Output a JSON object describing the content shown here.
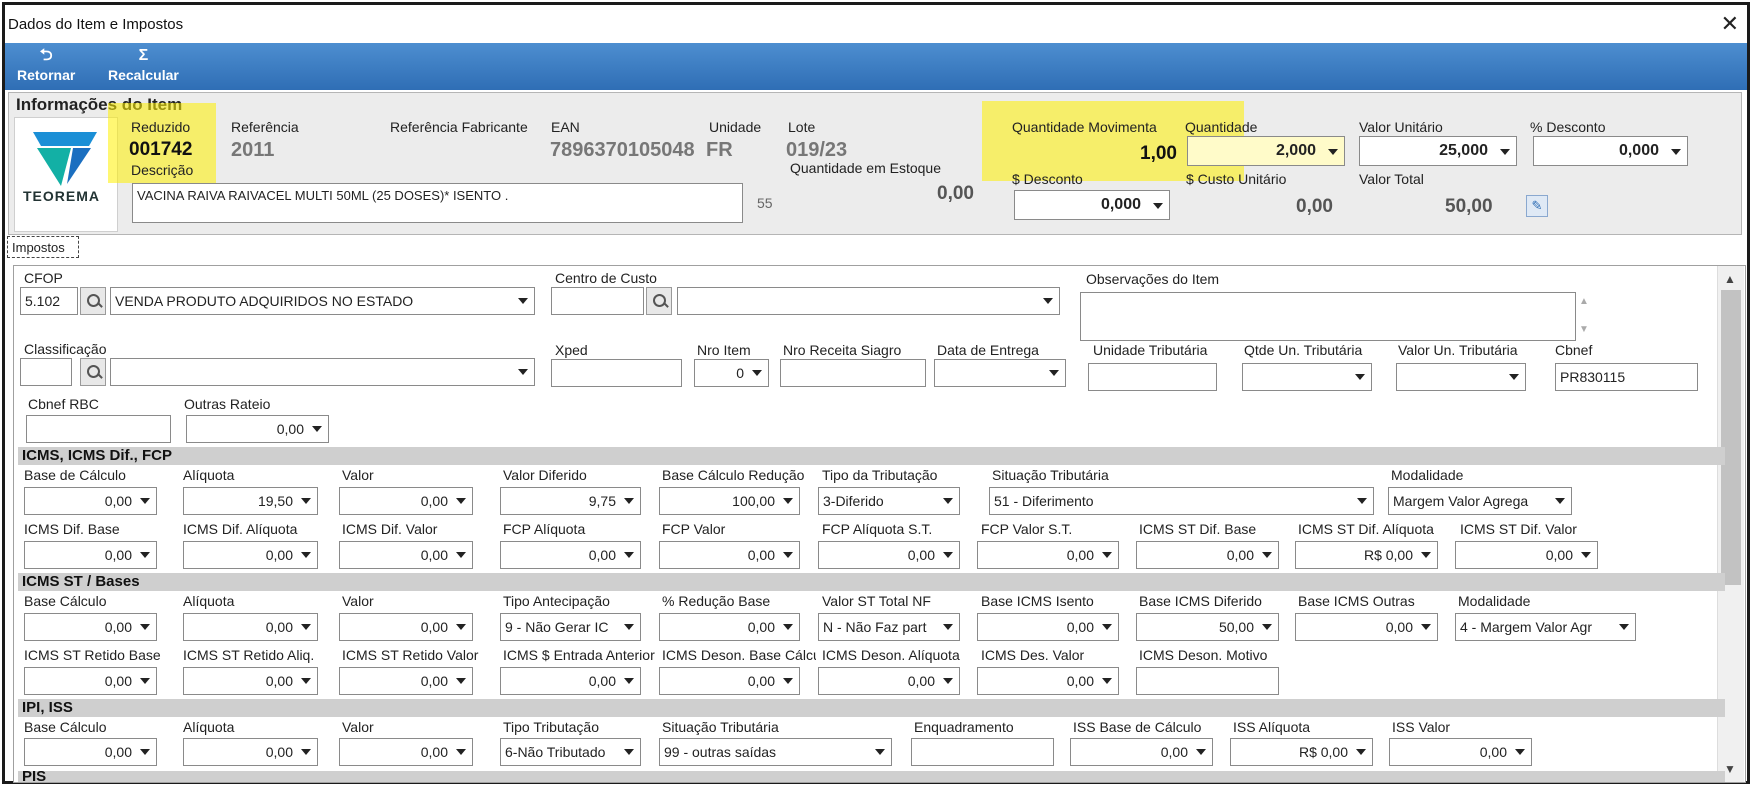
{
  "window": {
    "title": "Dados do Item e Impostos",
    "close": "✕"
  },
  "toolbar": {
    "back_label": "Retornar",
    "recalc_label": "Recalcular"
  },
  "info": {
    "section_title": "Informações do Item",
    "brand": "TEOREMA",
    "reduzido_label": "Reduzido",
    "reduzido_value": "001742",
    "descricao_label": "Descrição",
    "descricao_value": "VACINA RAIVA RAIVACEL MULTI 50ML (25 DOSES)* ISENTO .",
    "desc_code": "55",
    "referencia_label": "Referência",
    "referencia_value": "2011",
    "ref_fabricante_label": "Referência Fabricante",
    "ean_label": "EAN",
    "ean_value": "7896370105048",
    "unidade_label": "Unidade",
    "unidade_value": "FR",
    "lote_label": "Lote",
    "lote_value": "019/23",
    "qtd_estoque_label": "Quantidade em Estoque",
    "qtd_estoque_value": "0,00",
    "qtd_mov_label": "Quantidade Movimenta",
    "qtd_mov_value": "1,00",
    "quantidade_label": "Quantidade",
    "quantidade_value": "2,000",
    "valor_unit_label": "Valor Unitário",
    "valor_unit_value": "25,000",
    "pct_desc_label": "% Desconto",
    "pct_desc_value": "0,000",
    "desconto_label": "$ Desconto",
    "desconto_value": "0,000",
    "custo_unit_label": "$ Custo Unitário",
    "custo_unit_value": "0,00",
    "valor_total_label": "Valor Total",
    "valor_total_value": "50,00"
  },
  "tab": {
    "impostos": "Impostos"
  },
  "fields": {
    "cfop_label": "CFOP",
    "cfop_code": "5.102",
    "cfop_desc": "VENDA PRODUTO ADQUIRIDOS NO ESTADO",
    "centro_label": "Centro de Custo",
    "obs_label": "Observações do Item",
    "classif_label": "Classificação",
    "xped_label": "Xped",
    "nro_item_label": "Nro Item",
    "nro_item_value": "0",
    "nro_receita_label": "Nro Receita Siagro",
    "data_entrega_label": "Data de Entrega",
    "un_trib_label": "Unidade Tributária",
    "qtde_un_trib_label": "Qtde Un. Tributária",
    "valor_un_trib_label": "Valor Un. Tributária",
    "cbnef_label": "Cbnef",
    "cbnef_value": "PR830115",
    "cbnef_rbc_label": "Cbnef RBC",
    "outras_rateio_label": "Outras Rateio",
    "outras_rateio_value": "0,00"
  },
  "icms": {
    "title": "ICMS, ICMS Dif., FCP",
    "r1": [
      {
        "label": "Base de Cálculo",
        "value": "0,00"
      },
      {
        "label": "Alíquota",
        "value": "19,50"
      },
      {
        "label": "Valor",
        "value": "0,00"
      },
      {
        "label": "Valor Diferido",
        "value": "9,75"
      },
      {
        "label": "Base Cálculo Redução",
        "value": "100,00"
      }
    ],
    "tipo_trib_label": "Tipo da Tributação",
    "tipo_trib_value": "3-Diferido",
    "sit_trib_label": "Situação Tributária",
    "sit_trib_value": "51 - Diferimento",
    "modalidade_label": "Modalidade",
    "modalidade_value": "Margem Valor Agrega",
    "r2": [
      {
        "label": "ICMS Dif. Base",
        "value": "0,00"
      },
      {
        "label": "ICMS Dif. Alíquota",
        "value": "0,00"
      },
      {
        "label": "ICMS Dif. Valor",
        "value": "0,00"
      },
      {
        "label": "FCP Alíquota",
        "value": "0,00"
      },
      {
        "label": "FCP Valor",
        "value": "0,00"
      },
      {
        "label": "FCP Alíquota S.T.",
        "value": "0,00"
      },
      {
        "label": "FCP Valor S.T.",
        "value": "0,00"
      },
      {
        "label": "ICMS ST Dif. Base",
        "value": "0,00"
      },
      {
        "label": "ICMS ST Dif. Alíquota",
        "value": "R$ 0,00"
      },
      {
        "label": "ICMS ST Dif. Valor",
        "value": "0,00"
      }
    ]
  },
  "icmsst": {
    "title": "ICMS ST / Bases",
    "r1": [
      {
        "label": "Base Cálculo",
        "value": "0,00"
      },
      {
        "label": "Alíquota",
        "value": "0,00"
      },
      {
        "label": "Valor",
        "value": "0,00"
      }
    ],
    "tipo_antecip_label": "Tipo Antecipação",
    "tipo_antecip_value": "9 - Não Gerar IC",
    "pct_red_label": "% Redução Base",
    "pct_red_value": "0,00",
    "valor_st_label": "Valor ST Total NF",
    "valor_st_value": "N - Não Faz part",
    "base_isento_label": "Base ICMS Isento",
    "base_isento_value": "0,00",
    "base_diferido_label": "Base ICMS Diferido",
    "base_diferido_value": "50,00",
    "base_outras_label": "Base ICMS Outras",
    "base_outras_value": "0,00",
    "modalidade_label": "Modalidade",
    "modalidade_value": "4 - Margem Valor Agr",
    "r2": [
      {
        "label": "ICMS ST Retido Base",
        "value": "0,00"
      },
      {
        "label": "ICMS ST Retido Aliq.",
        "value": "0,00"
      },
      {
        "label": "ICMS ST Retido Valor",
        "value": "0,00"
      },
      {
        "label": "ICMS $ Entrada Anterior",
        "value": "0,00"
      },
      {
        "label": "ICMS Deson. Base Cálculo",
        "value": "0,00"
      },
      {
        "label": "ICMS Deson. Alíquota",
        "value": "0,00"
      },
      {
        "label": "ICMS Des. Valor",
        "value": "0,00"
      }
    ],
    "deson_motivo_label": "ICMS Deson. Motivo"
  },
  "ipi": {
    "title": "IPI, ISS",
    "r1": [
      {
        "label": "Base Cálculo",
        "value": "0,00"
      },
      {
        "label": "Alíquota",
        "value": "0,00"
      },
      {
        "label": "Valor",
        "value": "0,00"
      }
    ],
    "tipo_trib_label": "Tipo Tributação",
    "tipo_trib_value": "6-Não Tributado",
    "sit_trib_label": "Situação Tributária",
    "sit_trib_value": "99 - outras saídas",
    "enquadramento_label": "Enquadramento",
    "iss_base_label": "ISS Base de Cálculo",
    "iss_base_value": "0,00",
    "iss_aliq_label": "ISS Alíquota",
    "iss_aliq_value": "R$ 0,00",
    "iss_valor_label": "ISS Valor",
    "iss_valor_value": "0,00"
  },
  "pis": {
    "title": "PIS"
  },
  "colors": {
    "toolbar": "#3a7ac2",
    "highlight": "#fff000",
    "logo_blue": "#1b8fd6",
    "logo_teal": "#13b0a5"
  }
}
